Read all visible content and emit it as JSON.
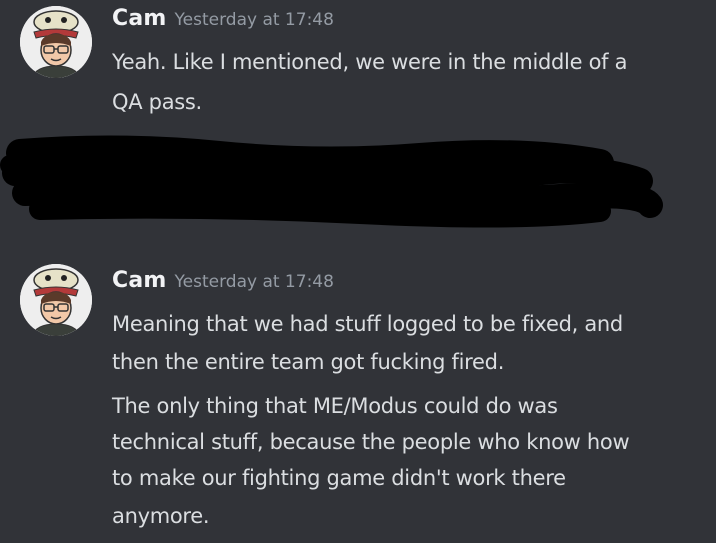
{
  "messages": [
    {
      "username": "Cam",
      "timestamp": "Yesterday at 17:48",
      "avatar_icon": "cartoon-character-avatar-icon",
      "lines": [
        "Yeah. Like I mentioned, we were in the middle of a",
        "QA pass."
      ]
    },
    {
      "username": "Cam",
      "timestamp": "Yesterday at 17:48",
      "avatar_icon": "cartoon-character-avatar-icon",
      "lines": [
        "Meaning that we had stuff logged to be fixed, and",
        "then the entire team got fucking fired.",
        "The only thing that ME/Modus could do was",
        "technical stuff, because the people who know how",
        "to make our fighting game didn't work there",
        "anymore."
      ]
    }
  ],
  "colors": {
    "background": "#313338",
    "username": "#f2f3f5",
    "timestamp": "#949ba4",
    "message_text": "#dbdee1",
    "redaction": "#000000"
  }
}
